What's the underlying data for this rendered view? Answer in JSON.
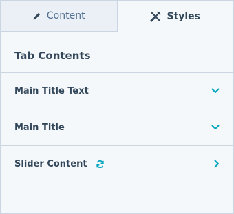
{
  "tabs": [
    {
      "label": "Content",
      "icon": "pencil-icon",
      "active": false
    },
    {
      "label": "Styles",
      "icon": "tools-icon",
      "active": true
    }
  ],
  "section": {
    "title": "Tab Contents"
  },
  "rows": [
    {
      "label": "Main Title Text",
      "indicator": "chevron-down-icon"
    },
    {
      "label": "Main Title",
      "indicator": "chevron-down-icon"
    },
    {
      "label": "Slider Content",
      "badge": "sync-icon",
      "indicator": "chevron-right-icon"
    }
  ],
  "colors": {
    "accent": "#00a4bd",
    "text": "#33475b",
    "border": "#cbd6e2",
    "tab_inactive_bg": "#eaf0f6"
  }
}
